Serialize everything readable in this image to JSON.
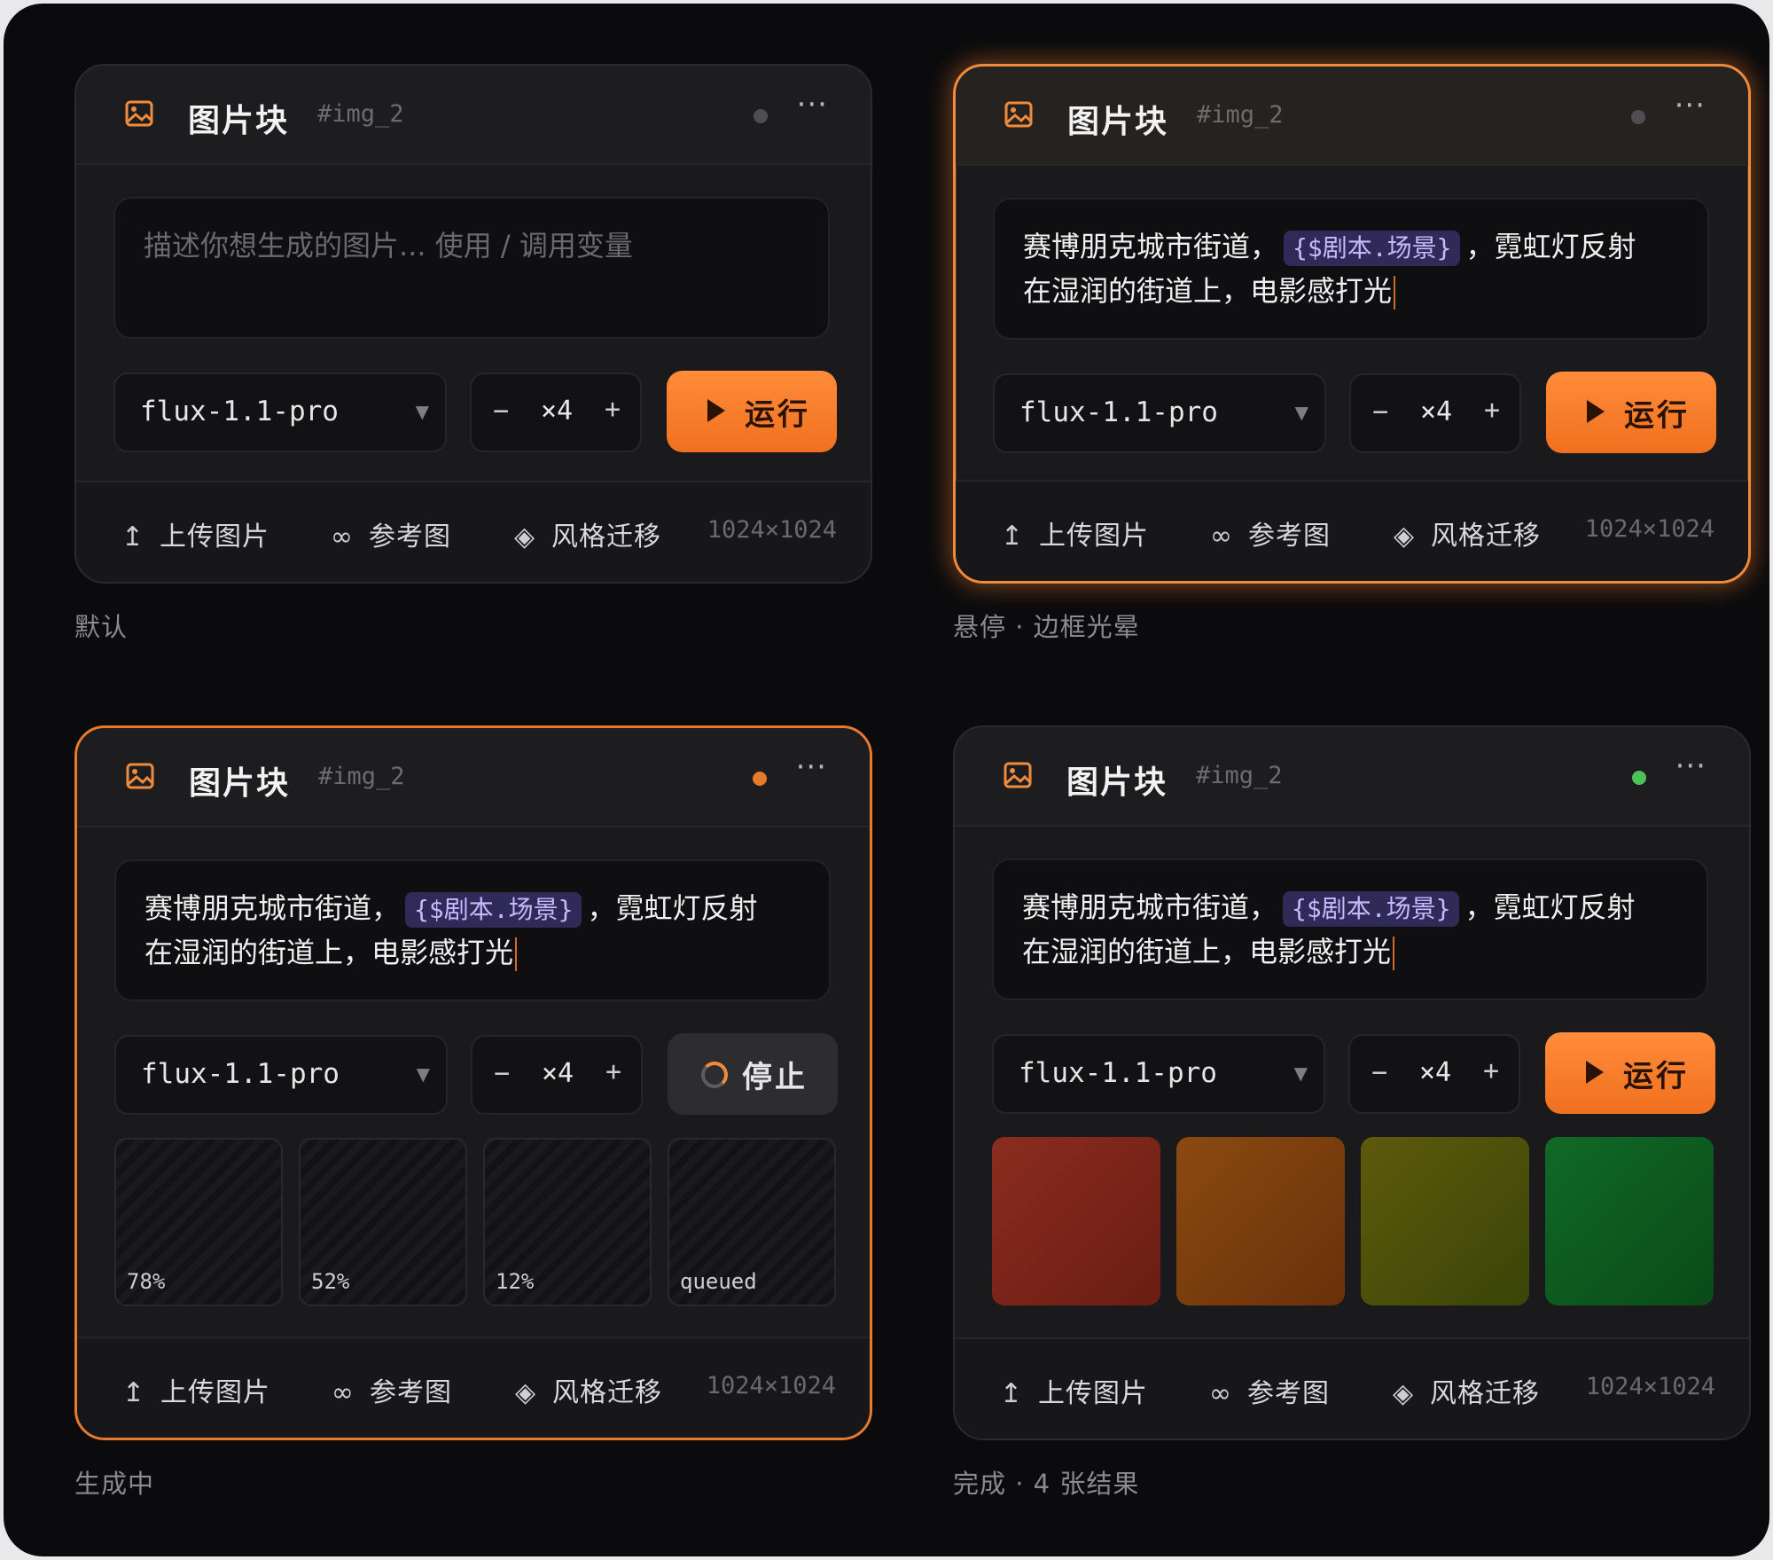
{
  "cards": [
    {
      "state": "default",
      "title": "图片块",
      "id": "#img_2",
      "status_color": "#4e4e52",
      "prompt_placeholder": "描述你想生成的图片... 使用 / 调用变量",
      "model": "flux-1.1-pro",
      "count": "×4",
      "action": "运行",
      "footer": {
        "upload": "上传图片",
        "reference": "参考图",
        "style": "风格迁移",
        "size": "1024×1024"
      },
      "caption": "默认"
    },
    {
      "state": "hover",
      "title": "图片块",
      "id": "#img_2",
      "status_color": "#4e4e52",
      "prompt_before": "赛博朋克城市街道，",
      "prompt_tag": "{$剧本.场景}",
      "prompt_after": "，霓虹灯反射",
      "prompt_line2": "在湿润的街道上，电影感打光",
      "model": "flux-1.1-pro",
      "count": "×4",
      "action": "运行",
      "footer": {
        "upload": "上传图片",
        "reference": "参考图",
        "style": "风格迁移",
        "size": "1024×1024"
      },
      "caption": "悬停 · 边框光晕"
    },
    {
      "state": "generating",
      "title": "图片块",
      "id": "#img_2",
      "status_color": "#e8782a",
      "prompt_before": "赛博朋克城市街道，",
      "prompt_tag": "{$剧本.场景}",
      "prompt_after": "，霓虹灯反射",
      "prompt_line2": "在湿润的街道上，电影感打光",
      "model": "flux-1.1-pro",
      "count": "×4",
      "action": "停止",
      "progress": [
        "78%",
        "52%",
        "12%",
        "queued"
      ],
      "footer": {
        "upload": "上传图片",
        "reference": "参考图",
        "style": "风格迁移",
        "size": "1024×1024"
      },
      "caption": "生成中"
    },
    {
      "state": "done",
      "title": "图片块",
      "id": "#img_2",
      "status_color": "#4cc25a",
      "prompt_before": "赛博朋克城市街道，",
      "prompt_tag": "{$剧本.场景}",
      "prompt_after": "，霓虹灯反射",
      "prompt_line2": "在湿润的街道上，电影感打光",
      "model": "flux-1.1-pro",
      "count": "×4",
      "action": "运行",
      "results": [
        "#8b2c20",
        "#8a4a10",
        "#5e5a0c",
        "#106a26"
      ],
      "footer": {
        "upload": "上传图片",
        "reference": "参考图",
        "style": "风格迁移",
        "size": "1024×1024"
      },
      "caption": "完成 · 4 张结果"
    }
  ],
  "icons": {
    "header": "image-icon",
    "more": "more-icon",
    "upload": "upload-icon",
    "reference": "link-icon",
    "style": "diamond-icon",
    "run": "play-icon",
    "stop": "spinner-icon"
  },
  "accent": "#f08a3c"
}
